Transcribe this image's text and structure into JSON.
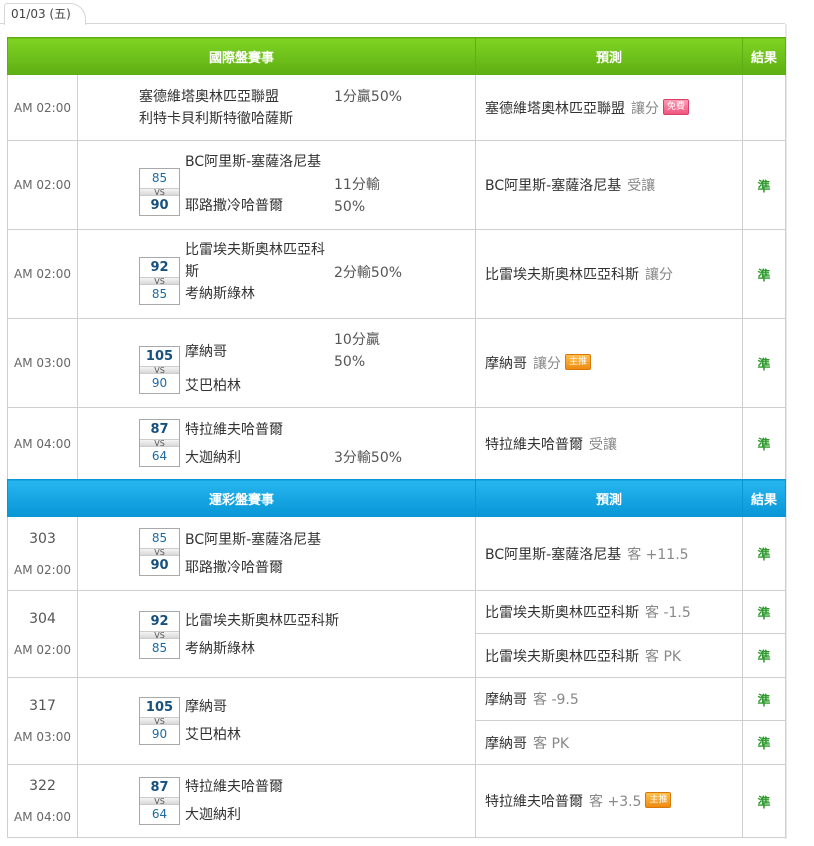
{
  "date_tab": "01/03 (五)",
  "intl": {
    "header": {
      "title": "國際盤賽事",
      "pred": "預測",
      "result": "結果"
    },
    "rows": [
      {
        "time": "AM 02:00",
        "home": "塞德維塔奧林匹亞聯盟",
        "away": "利特卡貝利斯特徹哈薩斯",
        "home_score": "",
        "away_score": "",
        "odds": "1分贏50%",
        "pred_team": "塞德維塔奧林匹亞聯盟",
        "pred_pick": "讓分",
        "badge": "免費",
        "result": ""
      },
      {
        "time": "AM 02:00",
        "home": "BC阿里斯-塞薩洛尼基",
        "away": "耶路撒冷哈普爾",
        "home_score": "85",
        "away_score": "90",
        "odds_1": "11分輸",
        "odds_2": "50%",
        "pred_team": "BC阿里斯-塞薩洛尼基",
        "pred_pick": "受讓",
        "result": "準"
      },
      {
        "time": "AM 02:00",
        "home_1": "比雷埃夫斯奧林匹亞科",
        "home_2": "斯",
        "away": "考納斯綠林",
        "home_score": "92",
        "away_score": "85",
        "odds": "2分輸50%",
        "pred_team": "比雷埃夫斯奧林匹亞科斯",
        "pred_pick": "讓分",
        "result": "準"
      },
      {
        "time": "AM 03:00",
        "home": "摩納哥",
        "away": "艾巴柏林",
        "home_score": "105",
        "away_score": "90",
        "odds_1": "10分贏",
        "odds_2": "50%",
        "pred_team": "摩納哥",
        "pred_pick": "讓分",
        "badge": "主推",
        "result": "準"
      },
      {
        "time": "AM 04:00",
        "home": "特拉維夫哈普爾",
        "away": "大迦納利",
        "home_score": "87",
        "away_score": "64",
        "odds": "3分輸50%",
        "pred_team": "特拉維夫哈普爾",
        "pred_pick": "受讓",
        "result": "準"
      }
    ]
  },
  "lottery": {
    "header": {
      "title": "運彩盤賽事",
      "pred": "預測",
      "result": "結果"
    },
    "rows": [
      {
        "code": "303",
        "time": "AM 02:00",
        "home": "BC阿里斯-塞薩洛尼基",
        "away": "耶路撒冷哈普爾",
        "home_score": "85",
        "away_score": "90",
        "preds": [
          {
            "team": "BC阿里斯-塞薩洛尼基",
            "pick": "客 +11.5",
            "result": "準"
          }
        ]
      },
      {
        "code": "304",
        "time": "AM 02:00",
        "home": "比雷埃夫斯奧林匹亞科斯",
        "away": "考納斯綠林",
        "home_score": "92",
        "away_score": "85",
        "preds": [
          {
            "team": "比雷埃夫斯奧林匹亞科斯",
            "pick": "客 -1.5",
            "result": "準"
          },
          {
            "team": "比雷埃夫斯奧林匹亞科斯",
            "pick": "客 PK",
            "result": "準"
          }
        ]
      },
      {
        "code": "317",
        "time": "AM 03:00",
        "home": "摩納哥",
        "away": "艾巴柏林",
        "home_score": "105",
        "away_score": "90",
        "preds": [
          {
            "team": "摩納哥",
            "pick": "客 -9.5",
            "result": "準"
          },
          {
            "team": "摩納哥",
            "pick": "客 PK",
            "result": "準"
          }
        ]
      },
      {
        "code": "322",
        "time": "AM 04:00",
        "home": "特拉維夫哈普爾",
        "away": "大迦納利",
        "home_score": "87",
        "away_score": "64",
        "preds": [
          {
            "team": "特拉維夫哈普爾",
            "pick": "客 +3.5",
            "badge": "主推",
            "result": "準"
          }
        ]
      }
    ]
  }
}
